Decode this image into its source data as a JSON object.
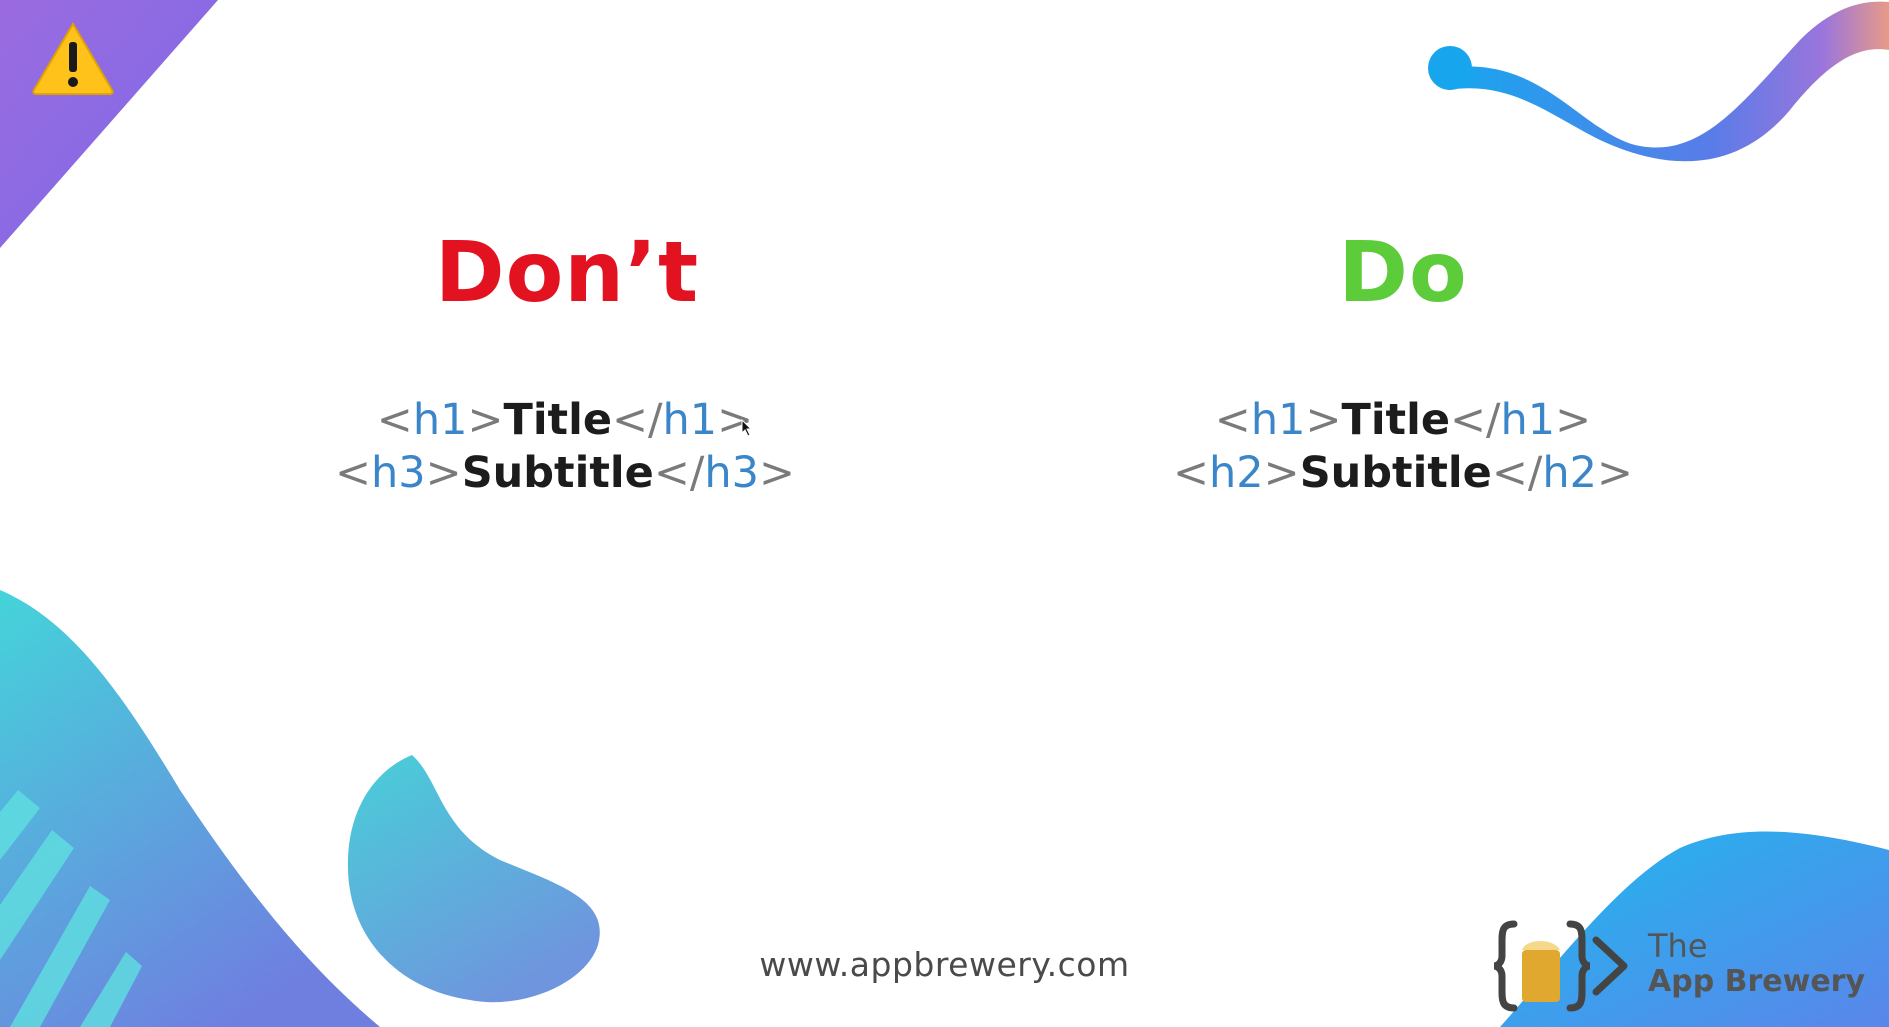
{
  "slide": {
    "dont_heading": "Don’t",
    "do_heading": "Do",
    "dont_code": [
      {
        "open_tag": "h1",
        "text": "Title",
        "close_tag": "h1"
      },
      {
        "open_tag": "h3",
        "text": "Subtitle",
        "close_tag": "h3"
      }
    ],
    "do_code": [
      {
        "open_tag": "h1",
        "text": "Title",
        "close_tag": "h1"
      },
      {
        "open_tag": "h2",
        "text": "Subtitle",
        "close_tag": "h2"
      }
    ],
    "footer_url": "www.appbrewery.com"
  },
  "logo": {
    "line1": "The",
    "line2": "App Brewery"
  },
  "icons": {
    "warning": "warning-icon",
    "cursor": "mouse-cursor-icon",
    "logo": "app-brewery-logo-icon"
  },
  "colors": {
    "dont": "#e31220",
    "do": "#5ccc3a",
    "tag": "#3a86c8",
    "bracket": "#7a7a7a",
    "text": "#1c1c1c"
  }
}
